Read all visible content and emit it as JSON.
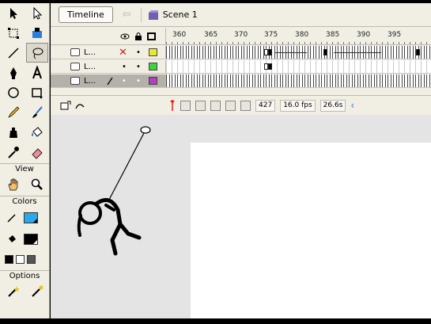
{
  "tools_panel": {
    "tools": [
      "arrow-icon",
      "subselect-icon",
      "free-transform-icon",
      "fill-transform-icon",
      "line-icon",
      "lasso-icon",
      "pen-icon",
      "text-icon",
      "oval-icon",
      "rectangle-icon",
      "pencil-icon",
      "brush-icon",
      "ink-bottle-icon",
      "paint-bucket-icon",
      "eyedropper-icon",
      "eraser-icon"
    ],
    "view_label": "View",
    "colors_label": "Colors",
    "options_label": "Options",
    "stroke_color": "#000000",
    "fill_color": "#2aa8e8"
  },
  "timeline": {
    "button_label": "Timeline",
    "scene_label": "Scene 1",
    "ruler_ticks": [
      "360",
      "365",
      "370",
      "375",
      "380",
      "385",
      "390",
      "395"
    ],
    "layers": [
      {
        "name": "L...",
        "visible_mark": "✕",
        "lock_mark": "•",
        "color": "#e8e830"
      },
      {
        "name": "L...",
        "visible_mark": "•",
        "lock_mark": "•",
        "color": "#40d040"
      },
      {
        "name": "L...",
        "visible_mark": "•",
        "lock_mark": "•",
        "color": "#b040c0"
      }
    ],
    "status": {
      "current_frame": "427",
      "frame_rate": "16.0 fps",
      "elapsed_time": "26.6s"
    }
  },
  "colors": {
    "panel_bg": "#f1eee4",
    "stage_bg": "#ffffff",
    "pasteboard": "#e4e4e4",
    "playhead": "#e02020"
  }
}
